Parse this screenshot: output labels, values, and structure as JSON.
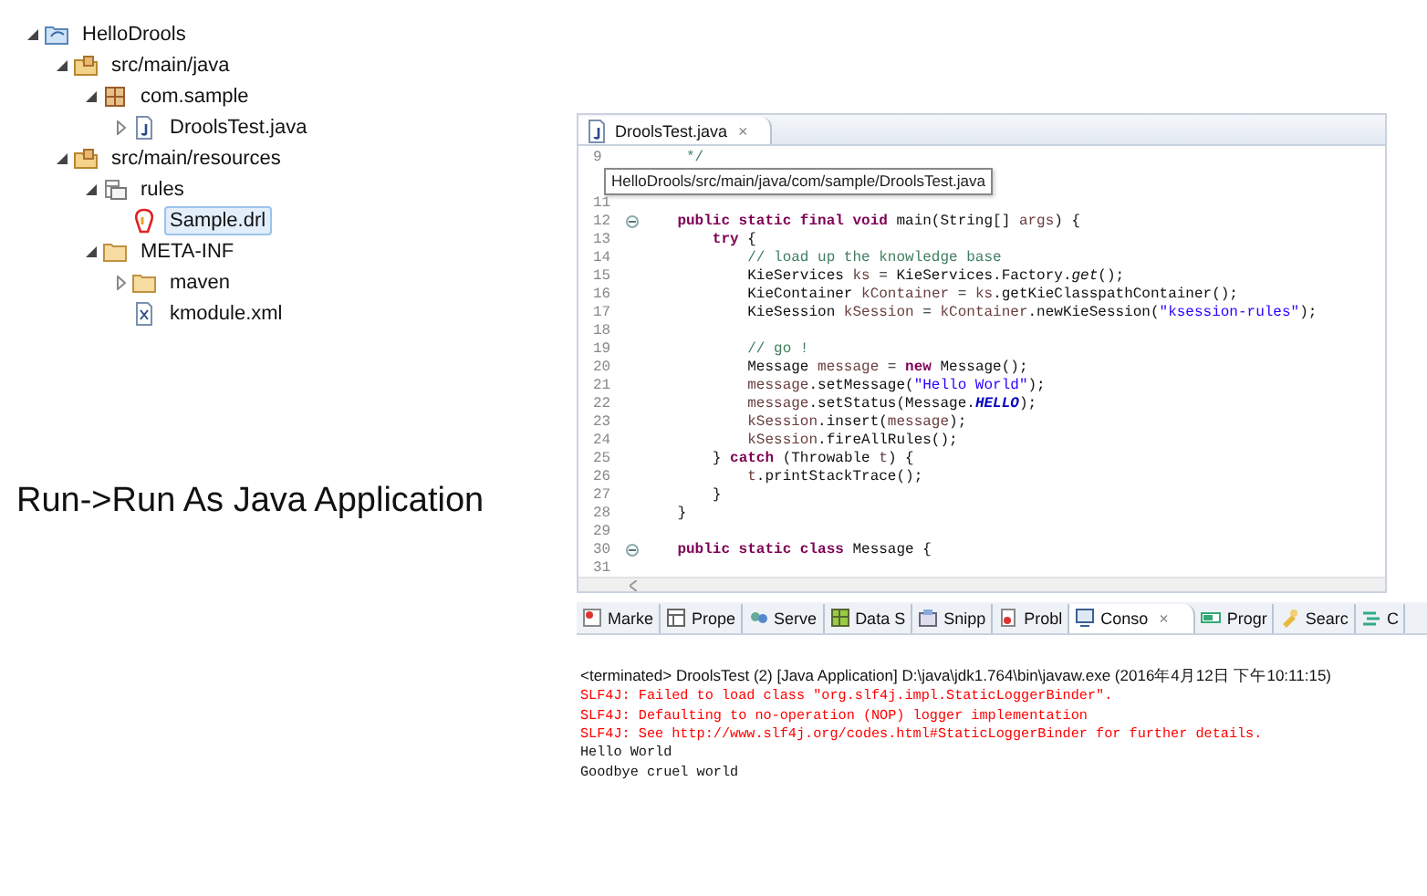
{
  "project_tree": [
    {
      "label": "HelloDrools",
      "kind": "project",
      "expanded": true,
      "selected": false,
      "children": [
        {
          "label": "src/main/java",
          "kind": "source-folder",
          "expanded": true,
          "selected": false,
          "children": [
            {
              "label": "com.sample",
              "kind": "package",
              "expanded": true,
              "selected": false,
              "children": [
                {
                  "label": "DroolsTest.java",
                  "kind": "java-file",
                  "expanded": false,
                  "selected": false
                }
              ]
            }
          ]
        },
        {
          "label": "src/main/resources",
          "kind": "source-folder",
          "expanded": true,
          "selected": false,
          "children": [
            {
              "label": "rules",
              "kind": "rules-package",
              "expanded": true,
              "selected": false,
              "children": [
                {
                  "label": "Sample.drl",
                  "kind": "drl-file",
                  "selected": true
                }
              ]
            },
            {
              "label": "META-INF",
              "kind": "folder",
              "expanded": true,
              "selected": false,
              "children": [
                {
                  "label": "maven",
                  "kind": "folder",
                  "expanded": false,
                  "selected": false
                },
                {
                  "label": "kmodule.xml",
                  "kind": "xml-file",
                  "selected": false
                }
              ]
            }
          ]
        }
      ]
    }
  ],
  "caption": "Run->Run As Java Application",
  "editor": {
    "tab": {
      "label": "DroolsTest.java",
      "close": "×"
    },
    "tooltip": "HelloDrools/src/main/java/com/sample/DroolsTest.java",
    "lines_above": [
      {
        "number": "9",
        "fold": false,
        "tokens": [
          {
            "kind": "comment",
            "text": "     */"
          }
        ]
      }
    ],
    "lines": [
      {
        "number": "11",
        "fold": false
      },
      {
        "number": "12",
        "fold": true,
        "tokens": [
          {
            "kind": "keyword",
            "text": "    public static final void"
          },
          {
            "kind": "plain",
            "text": " main(String[] "
          },
          {
            "kind": "variable",
            "text": "args"
          },
          {
            "kind": "plain",
            "text": ") {"
          }
        ]
      },
      {
        "number": "13",
        "fold": false,
        "tokens": [
          {
            "kind": "keyword",
            "text": "        try"
          },
          {
            "kind": "plain",
            "text": " {"
          }
        ]
      },
      {
        "number": "14",
        "fold": false,
        "tokens": [
          {
            "kind": "comment",
            "text": "            // load up the knowledge base"
          }
        ]
      },
      {
        "number": "15",
        "fold": false,
        "tokens": [
          {
            "kind": "plain",
            "text": "            KieServices "
          },
          {
            "kind": "variable",
            "text": "ks"
          },
          {
            "kind": "plain",
            "text": " = KieServices.Factory."
          },
          {
            "kind": "static",
            "text": "get"
          },
          {
            "kind": "plain",
            "text": "();"
          }
        ]
      },
      {
        "number": "16",
        "fold": false,
        "tokens": [
          {
            "kind": "plain",
            "text": "            KieContainer "
          },
          {
            "kind": "variable",
            "text": "kContainer"
          },
          {
            "kind": "plain",
            "text": " = "
          },
          {
            "kind": "variable",
            "text": "ks"
          },
          {
            "kind": "plain",
            "text": ".getKieClasspathContainer();"
          }
        ]
      },
      {
        "number": "17",
        "fold": false,
        "tokens": [
          {
            "kind": "plain",
            "text": "            KieSession "
          },
          {
            "kind": "variable",
            "text": "kSession"
          },
          {
            "kind": "plain",
            "text": " = "
          },
          {
            "kind": "variable",
            "text": "kContainer"
          },
          {
            "kind": "plain",
            "text": ".newKieSession("
          },
          {
            "kind": "string",
            "text": "\"ksession-rules\""
          },
          {
            "kind": "plain",
            "text": ");"
          }
        ]
      },
      {
        "number": "18",
        "fold": false
      },
      {
        "number": "19",
        "fold": false,
        "tokens": [
          {
            "kind": "comment",
            "text": "            // go !"
          }
        ]
      },
      {
        "number": "20",
        "fold": false,
        "tokens": [
          {
            "kind": "plain",
            "text": "            Message "
          },
          {
            "kind": "variable",
            "text": "message"
          },
          {
            "kind": "plain",
            "text": " = "
          },
          {
            "kind": "keyword",
            "text": "new"
          },
          {
            "kind": "plain",
            "text": " Message();"
          }
        ]
      },
      {
        "number": "21",
        "fold": false,
        "tokens": [
          {
            "kind": "variable",
            "text": "            message"
          },
          {
            "kind": "plain",
            "text": ".setMessage("
          },
          {
            "kind": "string",
            "text": "\"Hello World\""
          },
          {
            "kind": "plain",
            "text": ");"
          }
        ]
      },
      {
        "number": "22",
        "fold": false,
        "tokens": [
          {
            "kind": "variable",
            "text": "            message"
          },
          {
            "kind": "plain",
            "text": ".setStatus(Message."
          },
          {
            "kind": "field",
            "text": "HELLO"
          },
          {
            "kind": "plain",
            "text": ");"
          }
        ]
      },
      {
        "number": "23",
        "fold": false,
        "tokens": [
          {
            "kind": "variable",
            "text": "            kSession"
          },
          {
            "kind": "plain",
            "text": ".insert("
          },
          {
            "kind": "variable",
            "text": "message"
          },
          {
            "kind": "plain",
            "text": ");"
          }
        ]
      },
      {
        "number": "24",
        "fold": false,
        "tokens": [
          {
            "kind": "variable",
            "text": "            kSession"
          },
          {
            "kind": "plain",
            "text": ".fireAllRules();"
          }
        ]
      },
      {
        "number": "25",
        "fold": false,
        "tokens": [
          {
            "kind": "plain",
            "text": "        } "
          },
          {
            "kind": "keyword",
            "text": "catch"
          },
          {
            "kind": "plain",
            "text": " (Throwable "
          },
          {
            "kind": "variable",
            "text": "t"
          },
          {
            "kind": "plain",
            "text": ") {"
          }
        ]
      },
      {
        "number": "26",
        "fold": false,
        "tokens": [
          {
            "kind": "variable",
            "text": "            t"
          },
          {
            "kind": "plain",
            "text": ".printStackTrace();"
          }
        ]
      },
      {
        "number": "27",
        "fold": false,
        "tokens": [
          {
            "kind": "plain",
            "text": "        }"
          }
        ]
      },
      {
        "number": "28",
        "fold": false,
        "tokens": [
          {
            "kind": "plain",
            "text": "    }"
          }
        ]
      },
      {
        "number": "29",
        "fold": false
      },
      {
        "number": "30",
        "fold": true,
        "tokens": [
          {
            "kind": "keyword",
            "text": "    public static class"
          },
          {
            "kind": "plain",
            "text": " Message {"
          }
        ]
      },
      {
        "number": "31",
        "fold": false
      }
    ]
  },
  "console": {
    "tabs": [
      {
        "label": "Marke",
        "kind": "markers",
        "selected": false
      },
      {
        "label": "Prope",
        "kind": "properties",
        "selected": false
      },
      {
        "label": "Serve",
        "kind": "servers",
        "selected": false
      },
      {
        "label": "Data S",
        "kind": "data",
        "selected": false
      },
      {
        "label": "Snipp",
        "kind": "snippets",
        "selected": false
      },
      {
        "label": "Probl",
        "kind": "problems",
        "selected": false
      },
      {
        "label": "Conso",
        "kind": "console",
        "selected": true,
        "close": "×"
      },
      {
        "label": "Progr",
        "kind": "progress",
        "selected": false
      },
      {
        "label": "Searc",
        "kind": "search",
        "selected": false
      },
      {
        "label": "C",
        "kind": "hierarchy",
        "selected": false
      }
    ],
    "header": "<terminated> DroolsTest (2) [Java Application] D:\\java\\jdk1.764\\bin\\javaw.exe (2016年4月12日 下午10:11:15)",
    "output": [
      {
        "kind": "error",
        "text": "SLF4J: Failed to load class \"org.slf4j.impl.StaticLoggerBinder\"."
      },
      {
        "kind": "error",
        "text": "SLF4J: Defaulting to no-operation (NOP) logger implementation"
      },
      {
        "kind": "error",
        "text": "SLF4J: See http://www.slf4j.org/codes.html#StaticLoggerBinder for further details."
      },
      {
        "kind": "output",
        "text": "Hello World"
      },
      {
        "kind": "output",
        "text": "Goodbye cruel world"
      }
    ]
  }
}
